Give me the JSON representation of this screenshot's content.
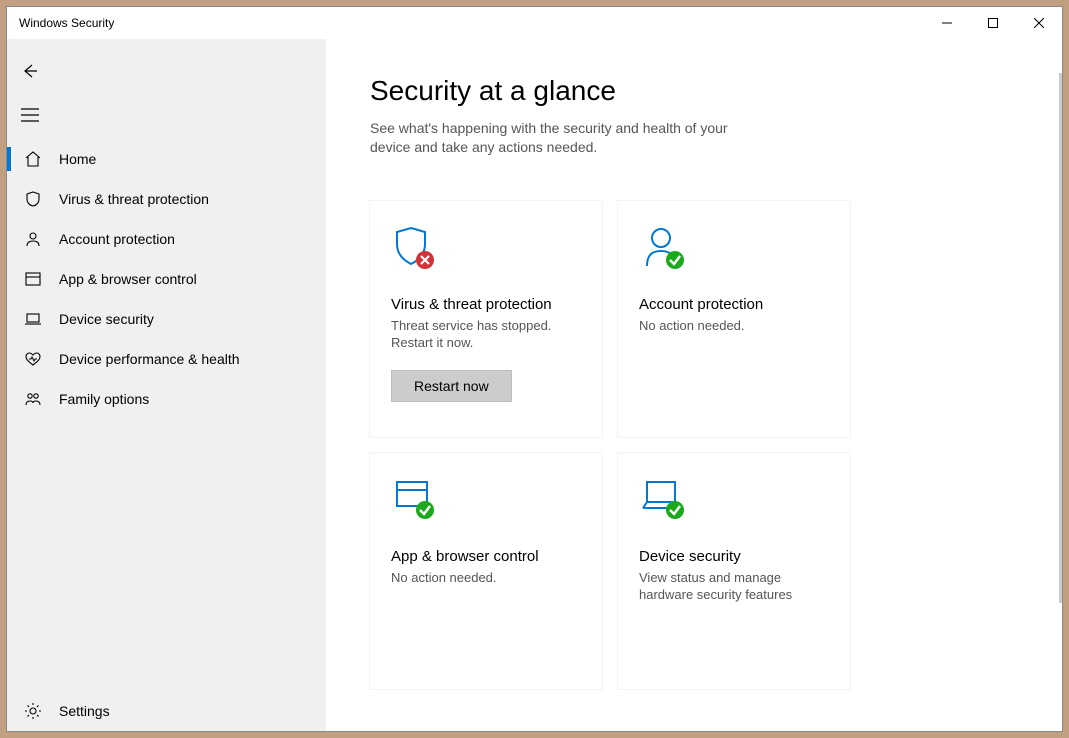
{
  "window": {
    "title": "Windows Security"
  },
  "sidebar": {
    "items": [
      {
        "label": "Home"
      },
      {
        "label": "Virus & threat protection"
      },
      {
        "label": "Account protection"
      },
      {
        "label": "App & browser control"
      },
      {
        "label": "Device security"
      },
      {
        "label": "Device performance & health"
      },
      {
        "label": "Family options"
      }
    ],
    "settings_label": "Settings"
  },
  "main": {
    "heading": "Security at a glance",
    "subtitle": "See what's happening with the security and health of your device and take any actions needed."
  },
  "cards": {
    "virus": {
      "title": "Virus & threat protection",
      "text": "Threat service has stopped. Restart it now.",
      "button": "Restart now"
    },
    "account": {
      "title": "Account protection",
      "text": "No action needed."
    },
    "appbrowser": {
      "title": "App & browser control",
      "text": "No action needed."
    },
    "device": {
      "title": "Device security",
      "text": "View status and manage hardware security features"
    }
  },
  "colors": {
    "accent": "#0078d4",
    "ok": "#1ca91c",
    "error": "#d13438"
  }
}
